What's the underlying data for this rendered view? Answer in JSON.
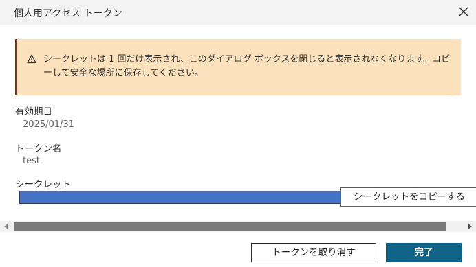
{
  "dialog": {
    "title": "個人用アクセス トークン",
    "close_icon": "close-icon"
  },
  "warning": {
    "icon": "warning-icon",
    "message": "シークレットは 1 回だけ表示され、このダイアログ ボックスを閉じると表示されなくなります。コピーして安全な場所に保存してください。",
    "colors": {
      "background": "#fbe2bd",
      "accent": "#6b3a1f"
    }
  },
  "fields": {
    "expiry_label": "有効期日",
    "expiry_value": "2025/01/31",
    "token_name_label": "トークン名",
    "token_name_value": "test",
    "secret_label": "シークレット"
  },
  "secret": {
    "copy_label": "シークレットをコピーする",
    "bar_color": "#4472c4"
  },
  "footer": {
    "cancel_label": "トークンを取り消す",
    "done_label": "完了",
    "done_color": "#0f6386"
  }
}
